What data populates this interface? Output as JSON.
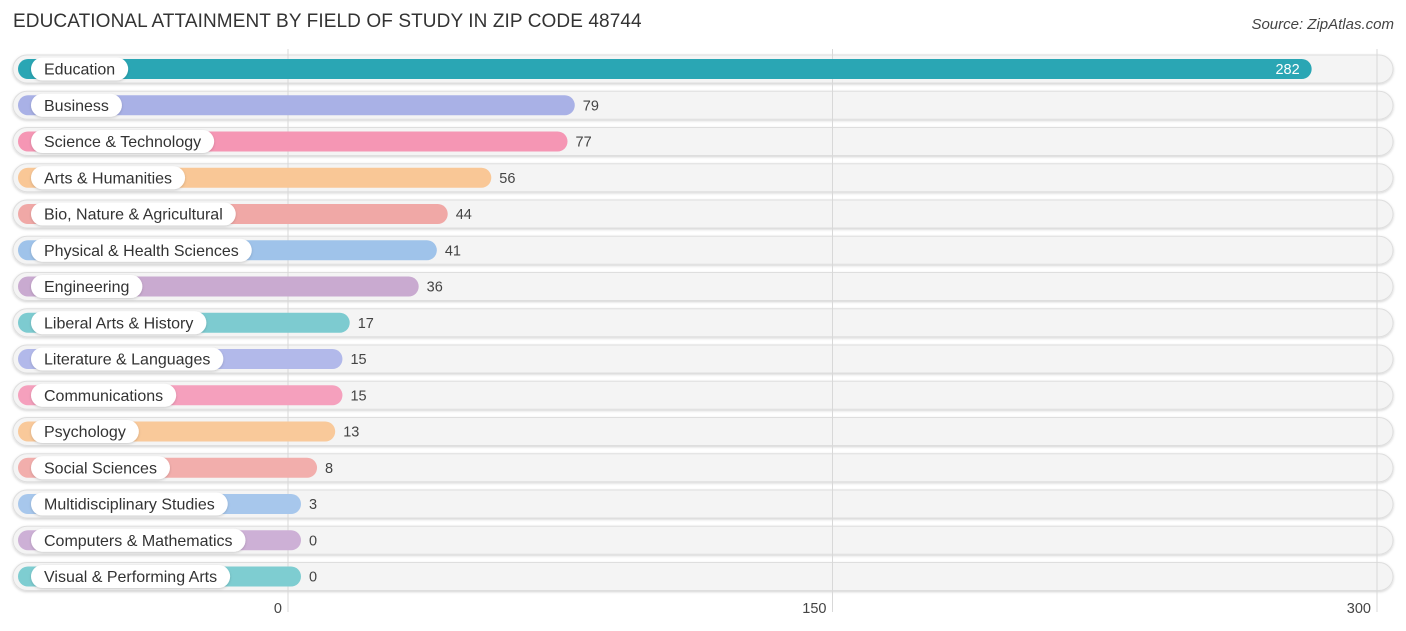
{
  "header": {
    "title": "EDUCATIONAL ATTAINMENT BY FIELD OF STUDY IN ZIP CODE 48744",
    "source": "Source: ZipAtlas.com"
  },
  "chart_data": {
    "type": "bar",
    "orientation": "horizontal",
    "title": "EDUCATIONAL ATTAINMENT BY FIELD OF STUDY IN ZIP CODE 48744",
    "xlabel": "",
    "ylabel": "",
    "xlim": [
      0,
      300
    ],
    "xticks": [
      0,
      150,
      300
    ],
    "xtick_labels": [
      "0",
      "150",
      "300"
    ],
    "grid": true,
    "categories": [
      "Education",
      "Business",
      "Science & Technology",
      "Arts & Humanities",
      "Bio, Nature & Agricultural",
      "Physical & Health Sciences",
      "Engineering",
      "Liberal Arts & History",
      "Literature & Languages",
      "Communications",
      "Psychology",
      "Social Sciences",
      "Multidisciplinary Studies",
      "Computers & Mathematics",
      "Visual & Performing Arts"
    ],
    "values": [
      282,
      79,
      77,
      56,
      44,
      41,
      36,
      17,
      15,
      15,
      13,
      8,
      3,
      0,
      0
    ],
    "colors": [
      "#2aa6b4",
      "#a9b1e6",
      "#f596b4",
      "#f9c796",
      "#f0a8a6",
      "#9fc3ea",
      "#c9aad0",
      "#7dcbd0",
      "#b2b9ea",
      "#f5a0bd",
      "#f9c99a",
      "#f2aeac",
      "#a7c7ec",
      "#cdb0d6",
      "#7ecdd1"
    ]
  }
}
